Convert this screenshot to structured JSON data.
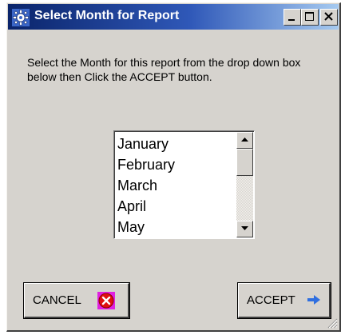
{
  "window": {
    "title": "Select Month for Report",
    "icon": "gear-icon",
    "caption_buttons": [
      "minimize-icon",
      "maximize-icon",
      "close-icon"
    ]
  },
  "instructions": "Select the Month for this report from the  drop down box below then Click the ACCEPT button.",
  "month_list": {
    "items": [
      "January",
      "February",
      "March",
      "April",
      "May"
    ]
  },
  "buttons": {
    "cancel": {
      "label": "CANCEL",
      "icon": "cancel-x-icon"
    },
    "accept": {
      "label": "ACCEPT",
      "icon": "arrow-right-icon"
    }
  },
  "colors": {
    "titlebar_start": "#0a246a",
    "titlebar_end": "#a6caf0",
    "dialog_bg": "#d6d3ce",
    "cancel_icon_bg": "#e020e0",
    "cancel_icon_fg": "#e01010",
    "accept_arrow": "#2f6fe0"
  }
}
